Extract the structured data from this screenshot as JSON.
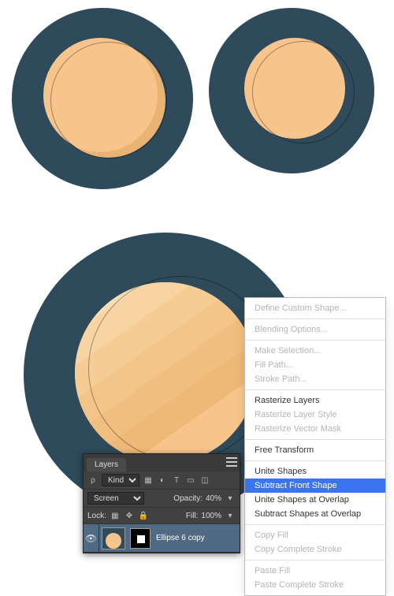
{
  "context_menu": {
    "items": [
      {
        "label": "Define Custom Shape...",
        "type": "item",
        "disabled": true
      },
      {
        "type": "sep"
      },
      {
        "label": "Blending Options...",
        "type": "item",
        "disabled": true
      },
      {
        "type": "sep"
      },
      {
        "label": "Make Selection...",
        "type": "item",
        "disabled": true
      },
      {
        "label": "Fill Path...",
        "type": "item",
        "disabled": true
      },
      {
        "label": "Stroke Path...",
        "type": "item",
        "disabled": true
      },
      {
        "type": "sep"
      },
      {
        "label": "Rasterize Layers",
        "type": "item"
      },
      {
        "label": "Rasterize Layer Style",
        "type": "item",
        "disabled": true
      },
      {
        "label": "Rasterize Vector Mask",
        "type": "item",
        "disabled": true
      },
      {
        "type": "sep"
      },
      {
        "label": "Free Transform",
        "type": "item"
      },
      {
        "type": "sep"
      },
      {
        "label": "Unite Shapes",
        "type": "item"
      },
      {
        "label": "Subtract Front Shape",
        "type": "item",
        "selected": true
      },
      {
        "label": "Unite Shapes at Overlap",
        "type": "item"
      },
      {
        "label": "Subtract Shapes at Overlap",
        "type": "item"
      },
      {
        "type": "sep"
      },
      {
        "label": "Copy Fill",
        "type": "item",
        "disabled": true
      },
      {
        "label": "Copy Complete Stroke",
        "type": "item",
        "disabled": true
      },
      {
        "type": "sep"
      },
      {
        "label": "Paste Fill",
        "type": "item",
        "disabled": true
      },
      {
        "label": "Paste Complete Stroke",
        "type": "item",
        "disabled": true
      }
    ]
  },
  "layers_panel": {
    "tab": "Layers",
    "kind_label": "Kind",
    "blend_mode": "Screen",
    "opacity_label": "Opacity:",
    "opacity_value": "40%",
    "lock_label": "Lock:",
    "fill_label": "Fill:",
    "fill_value": "100%",
    "layer_name": "Ellipse 6 copy"
  },
  "colors": {
    "ring": "#2e4a5b",
    "disc": "#f7c48c",
    "disc_shadow": "#e8b373",
    "stripe_light": "#fbe2bb",
    "stripe_mid": "#f5d09e",
    "highlight": "#3a74ee"
  }
}
